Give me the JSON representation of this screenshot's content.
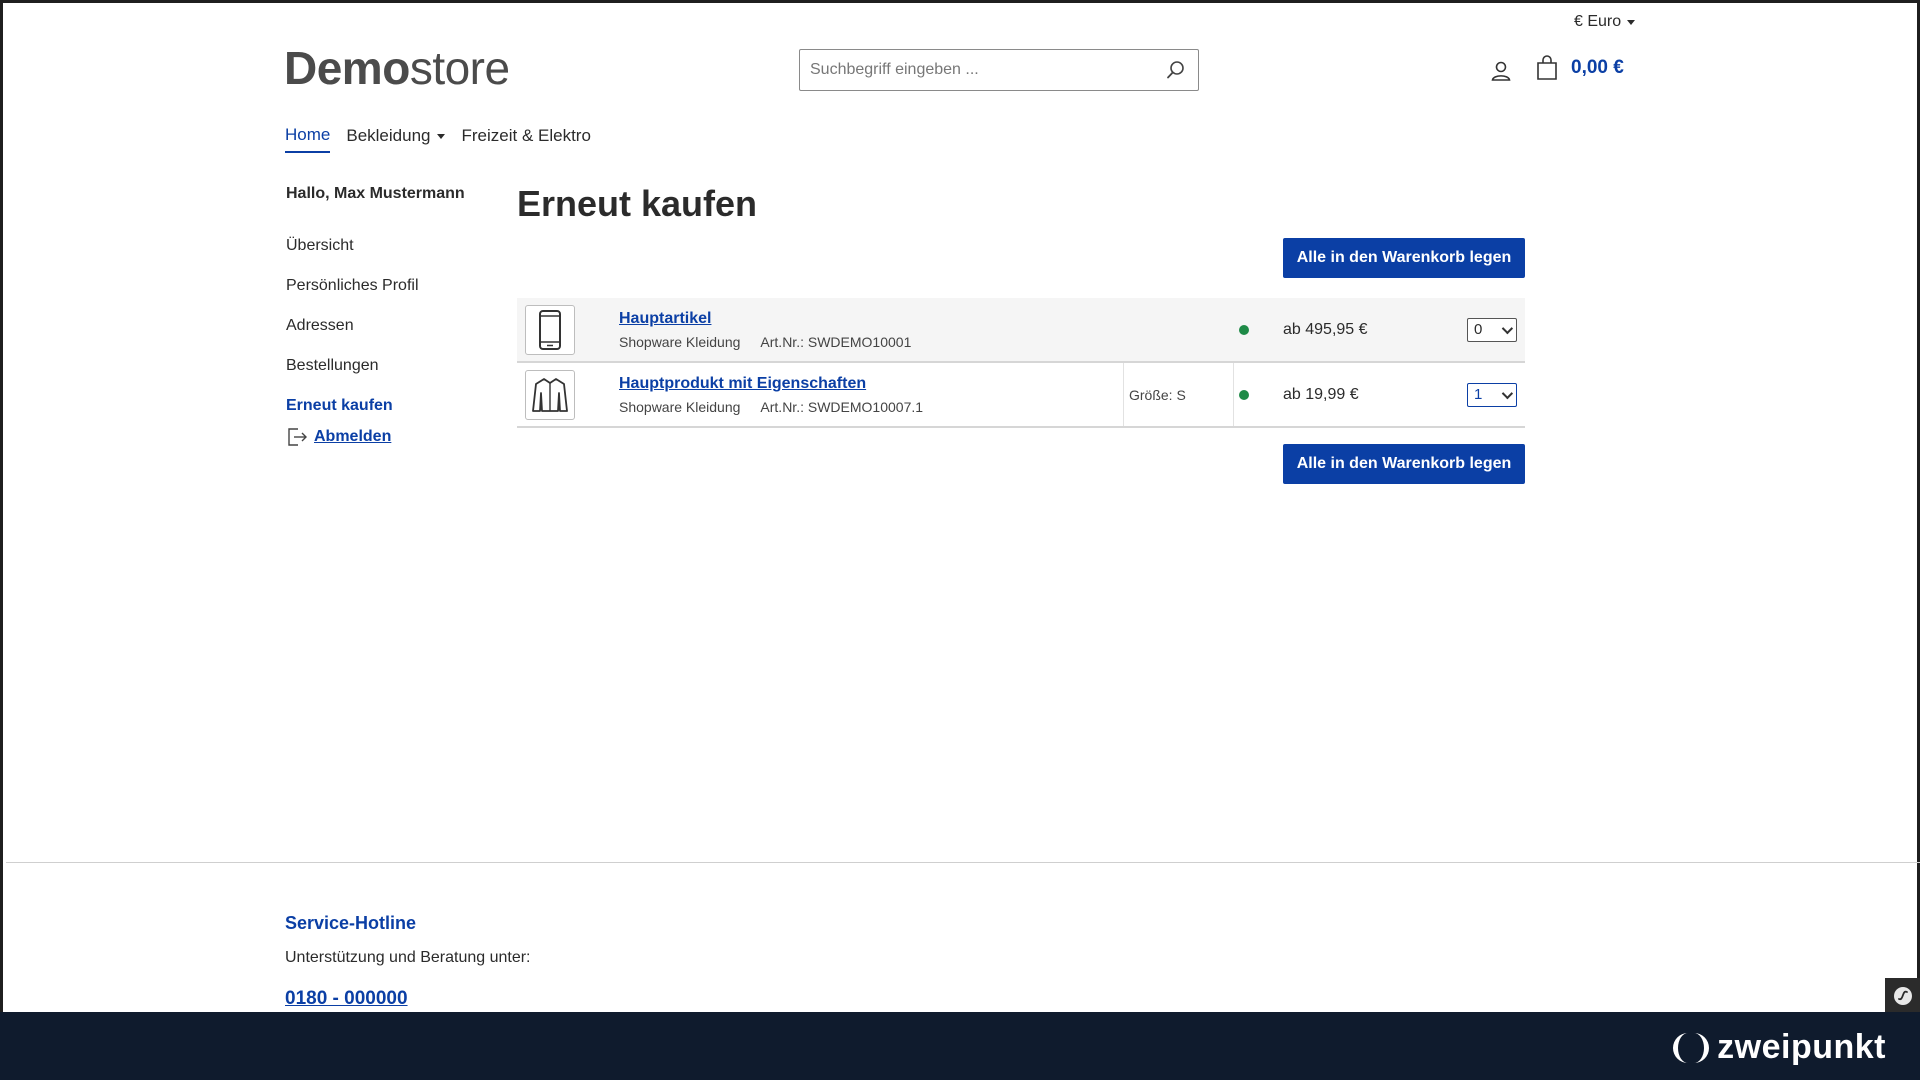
{
  "header": {
    "currency_label": "€ Euro",
    "logo_bold": "Demo",
    "logo_light": "store",
    "search_placeholder": "Suchbegriff eingeben ...",
    "cart_total": "0,00 €"
  },
  "nav": {
    "items": [
      {
        "label": "Home",
        "active": true
      },
      {
        "label": "Bekleidung",
        "has_dropdown": true
      },
      {
        "label": "Freizeit & Elektro"
      }
    ]
  },
  "sidebar": {
    "greeting": "Hallo, Max Mustermann",
    "items": [
      {
        "label": "Übersicht"
      },
      {
        "label": "Persönliches Profil"
      },
      {
        "label": "Adressen"
      },
      {
        "label": "Bestellungen"
      },
      {
        "label": "Erneut kaufen",
        "active": true
      }
    ],
    "logout_label": "Abmelden"
  },
  "main": {
    "title": "Erneut kaufen",
    "add_all_label": "Alle in den Warenkorb legen",
    "products": [
      {
        "name": "Hauptartikel",
        "manufacturer": "Shopware Kleidung",
        "sku": "Art.Nr.: SWDEMO10001",
        "variant": "",
        "price": "ab 495,95 €",
        "quantity": "0",
        "thumb_icon": "smartphone-icon"
      },
      {
        "name": "Hauptprodukt mit Eigenschaften",
        "manufacturer": "Shopware Kleidung",
        "sku": "Art.Nr.: SWDEMO10007.1",
        "variant": "Größe: S",
        "price": "ab 19,99 €",
        "quantity": "1",
        "thumb_icon": "jacket-icon"
      }
    ]
  },
  "footer": {
    "hotline_title": "Service-Hotline",
    "hotline_subtitle": "Unterstützung und Beratung unter:",
    "hotline_number": "0180 - 000000"
  },
  "banner": {
    "brand": "zweipunkt"
  },
  "colors": {
    "accent": "#0b3fa5",
    "in_stock": "#1e8a47",
    "banner_bg": "#0f1b2d"
  }
}
